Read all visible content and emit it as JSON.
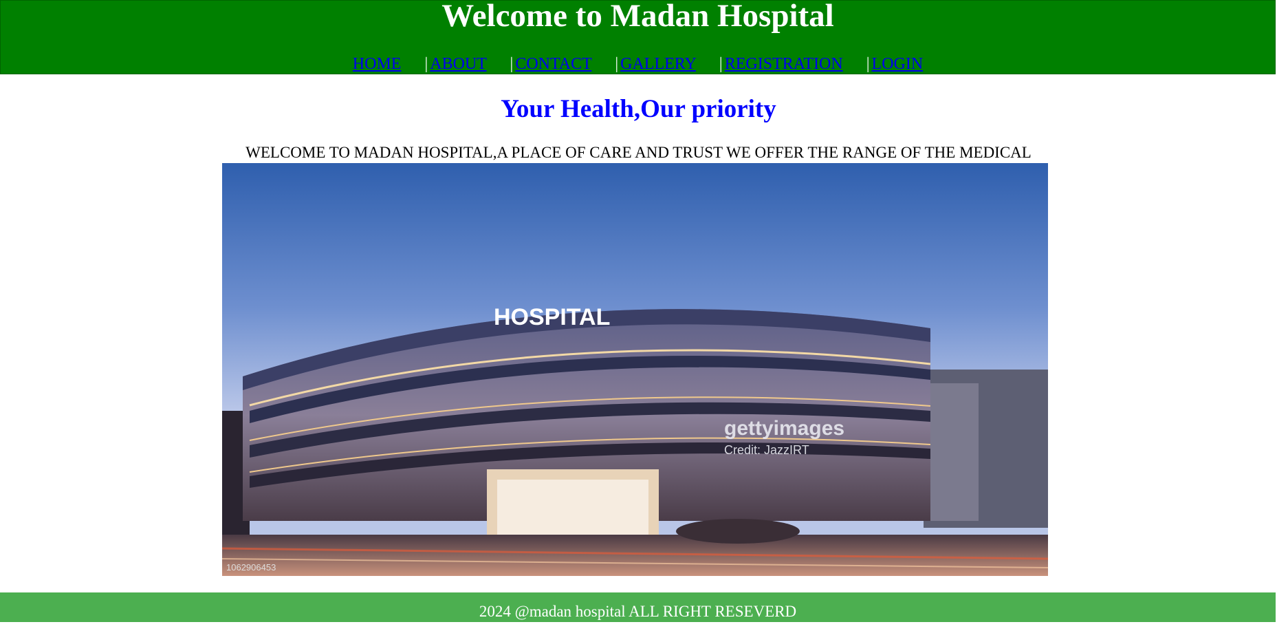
{
  "header": {
    "title": "Welcome to Madan Hospital",
    "nav": [
      {
        "label": "HOME"
      },
      {
        "label": "ABOUT"
      },
      {
        "label": "CONTACT"
      },
      {
        "label": "GALLERY"
      },
      {
        "label": "REGISTRATION"
      },
      {
        "label": "LOGIN"
      }
    ],
    "separator": "|"
  },
  "main": {
    "tagline": "Your Health,Our priority",
    "intro": "WELCOME TO MADAN HOSPITAL,A PLACE OF CARE AND TRUST WE OFFER THE RANGE OF THE MEDICAL",
    "hero_image": {
      "sign_text": "HOSPITAL",
      "watermark": "gettyimages",
      "credit": "Credit: JazzIRT",
      "image_id": "1062906453"
    }
  },
  "footer": {
    "text": "2024 @madan hospital ALL RIGHT RESEVERD"
  },
  "colors": {
    "header_bg": "#008000",
    "footer_bg": "#4caf50",
    "tagline": "#0000ff",
    "link": "#0000ee"
  }
}
